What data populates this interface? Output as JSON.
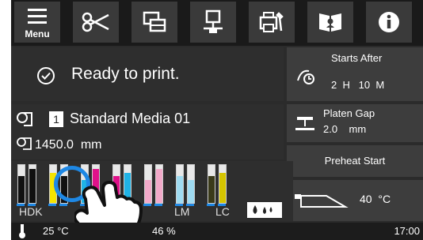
{
  "toolbar": {
    "menu_label": "Menu",
    "icons": [
      "menu-icon",
      "cut-icon",
      "copy-layers-icon",
      "network-icon",
      "printer-settings-icon",
      "book-icon",
      "info-icon"
    ]
  },
  "status": {
    "text": "Ready to print."
  },
  "starts_after": {
    "label": "Starts After",
    "value": "2  H   10  M"
  },
  "media": {
    "number": "1",
    "name": "Standard Media 01",
    "length": "1450.0  mm"
  },
  "platen_gap": {
    "label": "Platen Gap",
    "value": "2.0    mm"
  },
  "preheat": {
    "label": "Preheat Start"
  },
  "heater": {
    "temp": "40  °C"
  },
  "inks": {
    "labels": [
      "HDK",
      "LM",
      "LC"
    ],
    "bars": [
      {
        "color": "#111111",
        "level": 0.7
      },
      {
        "color": "#111111",
        "level": 0.9
      },
      {
        "color": "#f5e400",
        "level": 0.8
      },
      {
        "color": "#111111",
        "level": 0.7
      },
      {
        "color": "#1fb3e6",
        "level": 0.6
      },
      {
        "color": "#e0118a",
        "level": 0.9
      },
      {
        "color": "#e0118a",
        "level": 0.7
      },
      {
        "color": "#1fb3e6",
        "level": 0.8
      },
      {
        "color": "#f2a9c9",
        "level": 0.6
      },
      {
        "color": "#f2a9c9",
        "level": 0.9
      },
      {
        "color": "#9fdbf1",
        "level": 0.7
      },
      {
        "color": "#9fdbf1",
        "level": 0.6
      },
      {
        "color": "#3a3a1a",
        "level": 0.7
      },
      {
        "color": "#d4c400",
        "level": 0.8
      }
    ]
  },
  "bottom": {
    "temp_left": "25 °C",
    "humidity": "46 %",
    "time": "17:00"
  },
  "colors": {
    "accent": "#1e88e5",
    "yellow_highlight": "#f5e400"
  }
}
